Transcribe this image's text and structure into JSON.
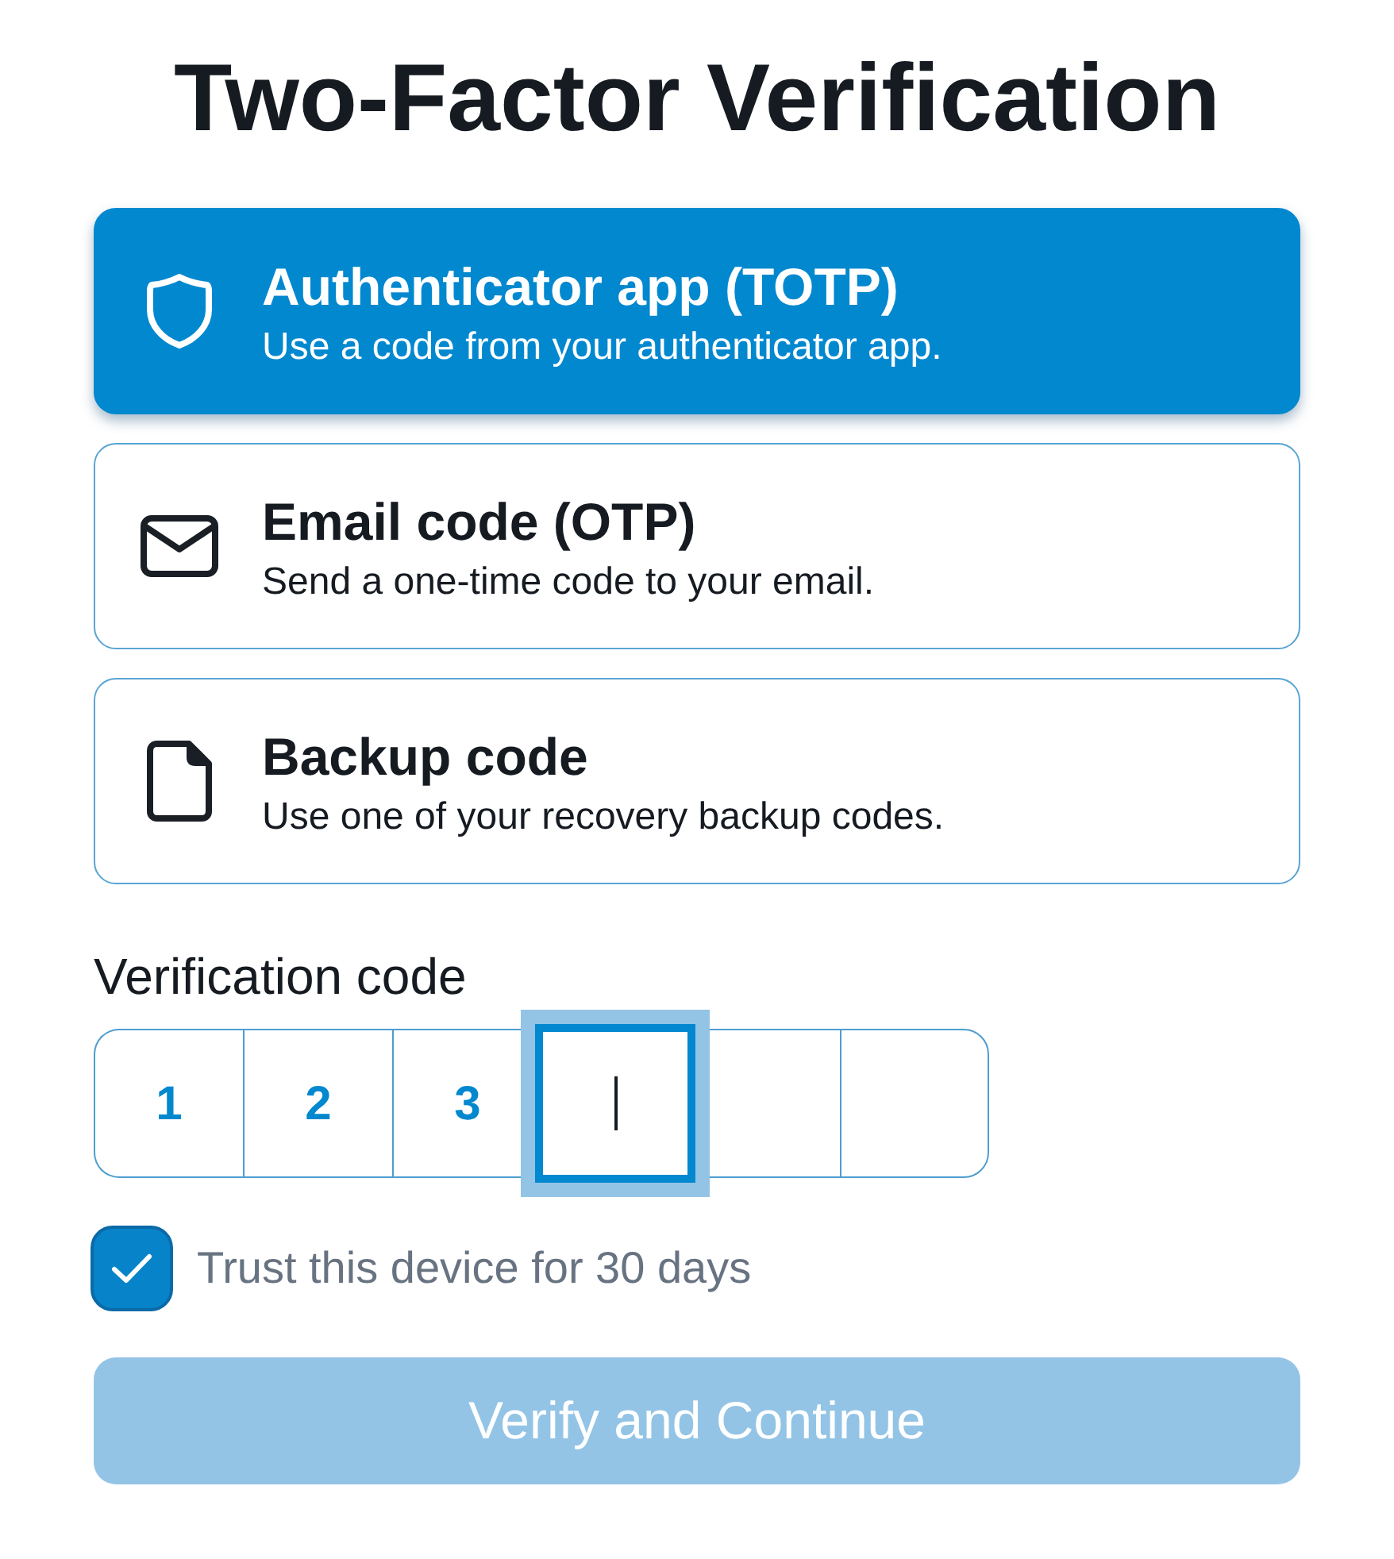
{
  "title": "Two-Factor Verification",
  "methods": [
    {
      "kind": "shield",
      "title": "Authenticator app (TOTP)",
      "description": "Use a code from your authenticator app.",
      "selected": true
    },
    {
      "kind": "mail",
      "title": "Email code (OTP)",
      "description": "Send a one-time code to your email.",
      "selected": false
    },
    {
      "kind": "file",
      "title": "Backup code",
      "description": "Use one of your recovery backup codes.",
      "selected": false
    }
  ],
  "verification_code": {
    "label": "Verification code",
    "cells": [
      {
        "value": "1",
        "focused": false
      },
      {
        "value": "2",
        "focused": false
      },
      {
        "value": "3",
        "focused": false
      },
      {
        "focused": true
      },
      {
        "focused": false
      },
      {
        "focused": false
      }
    ]
  },
  "trust_device": {
    "label": "Trust this device for 30 days",
    "checked": true
  },
  "submit_button": {
    "label": "Verify and Continue",
    "disabled": true
  }
}
